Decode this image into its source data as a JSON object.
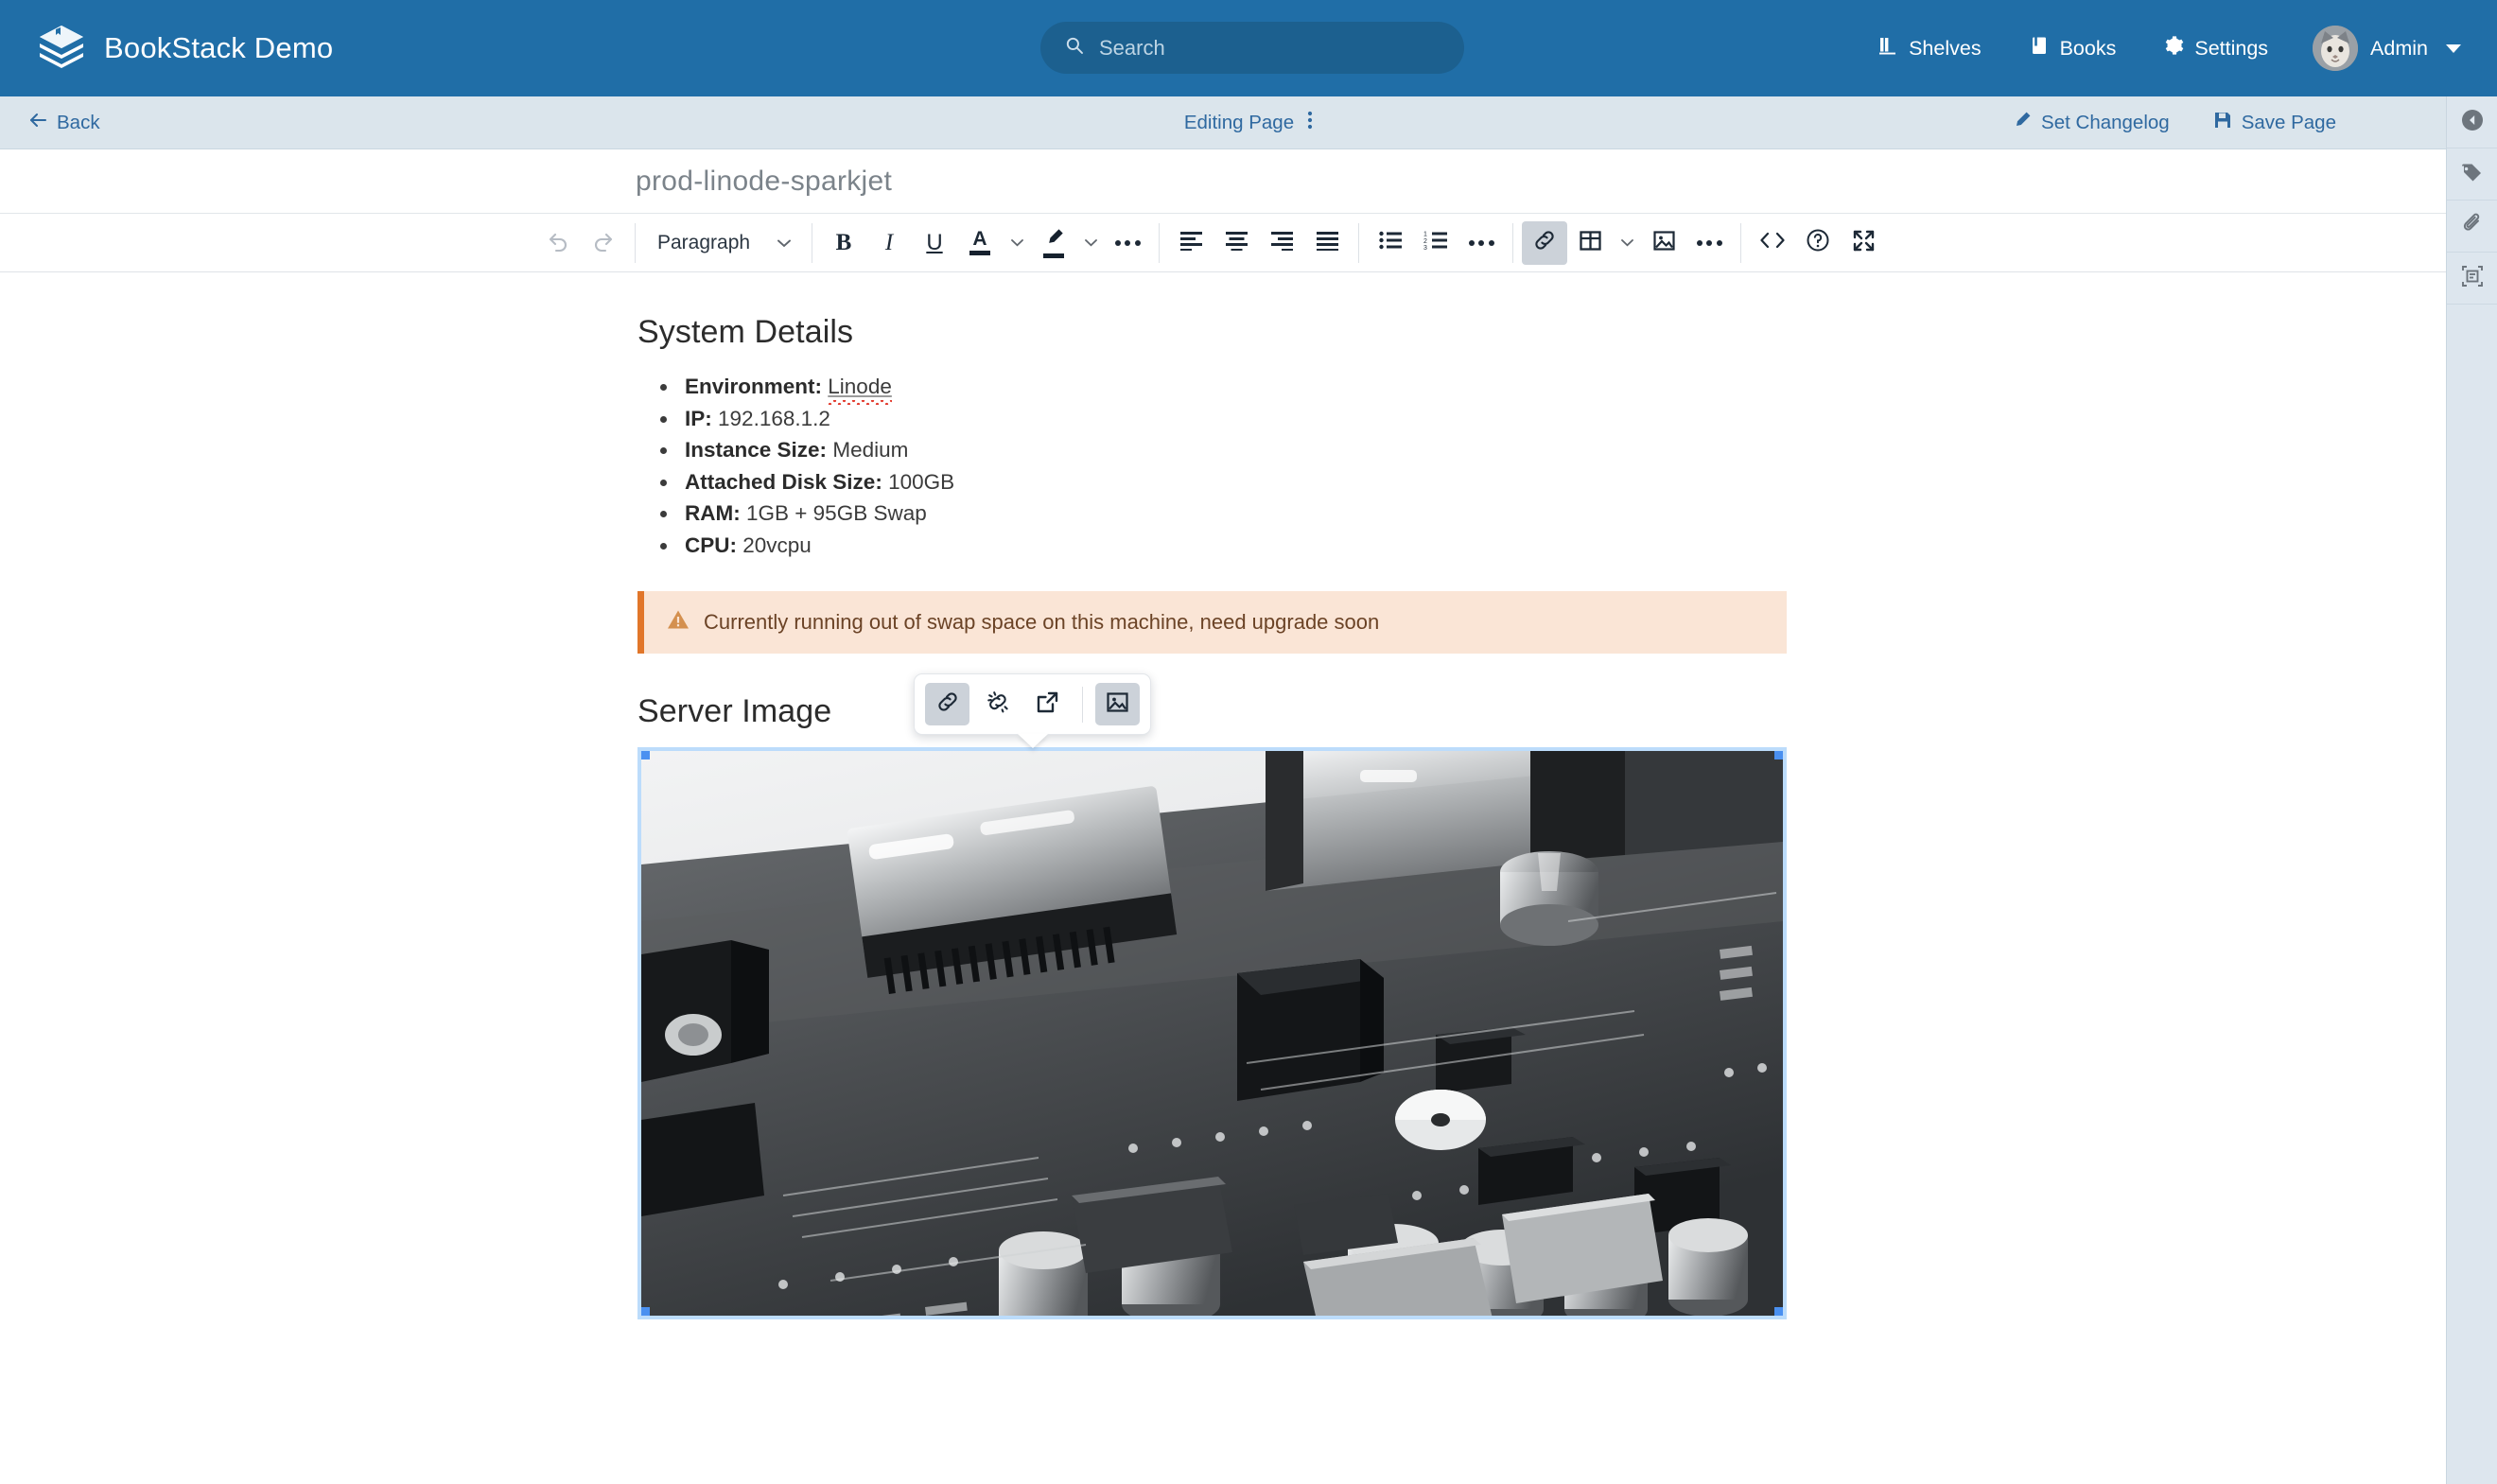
{
  "app": {
    "brand_name": "BookStack Demo",
    "logo_icon": "stacked-books-icon",
    "header_color": "#206ea7",
    "accent_color": "#2f69a0"
  },
  "search": {
    "placeholder": "Search",
    "value": "",
    "icon": "search-icon"
  },
  "header_nav": [
    {
      "label": "Shelves",
      "icon": "shelves-icon"
    },
    {
      "label": "Books",
      "icon": "book-icon"
    },
    {
      "label": "Settings",
      "icon": "gear-icon"
    }
  ],
  "user": {
    "name": "Admin",
    "avatar_icon": "cat-avatar",
    "caret_icon": "chevron-down-icon"
  },
  "action_bar": {
    "back_label": "Back",
    "back_icon": "arrow-left-icon",
    "status_label": "Editing Page",
    "status_menu_icon": "vertical-dots-icon",
    "changelog_label": "Set Changelog",
    "changelog_icon": "pencil-icon",
    "save_label": "Save Page",
    "save_icon": "floppy-disk-icon"
  },
  "rail": [
    {
      "icon": "collapse-left-icon",
      "name": "sidebar-toggle"
    },
    {
      "icon": "tag-icon",
      "name": "page-tags"
    },
    {
      "icon": "paperclip-icon",
      "name": "page-attachments"
    },
    {
      "icon": "template-icon",
      "name": "page-templates"
    }
  ],
  "page": {
    "title": "prod-linode-sparkjet"
  },
  "toolbar": {
    "undo_icon": "undo-icon",
    "redo_icon": "redo-icon",
    "format_value": "Paragraph",
    "format_caret": "chevron-down-icon",
    "bold_label": "B",
    "italic_label": "I",
    "underline_label": "U",
    "text_color_label": "A",
    "text_color_caret": "chevron-down-icon",
    "highlight_icon": "highlighter-icon",
    "highlight_caret": "chevron-down-icon",
    "format_more_icon": "ellipsis-icon",
    "align_left_icon": "align-left-icon",
    "align_center_icon": "align-center-icon",
    "align_right_icon": "align-right-icon",
    "align_justify_icon": "align-justify-icon",
    "bullet_list_icon": "bullet-list-icon",
    "numbered_list_icon": "numbered-list-icon",
    "list_more_icon": "ellipsis-icon",
    "link_icon": "link-icon",
    "table_icon": "table-icon",
    "table_caret": "chevron-down-icon",
    "image_icon": "image-icon",
    "insert_more_icon": "ellipsis-icon",
    "source_code_icon": "code-icon",
    "help_icon": "question-circle-icon",
    "fullscreen_icon": "fullscreen-icon"
  },
  "content": {
    "heading_system": "System Details",
    "details": [
      {
        "label": "Environment:",
        "value": "Linode",
        "misspelled": true
      },
      {
        "label": "IP:",
        "value": "192.168.1.2",
        "misspelled": false
      },
      {
        "label": "Instance Size:",
        "value": "Medium",
        "misspelled": false
      },
      {
        "label": "Attached Disk Size:",
        "value": "100GB",
        "misspelled": false
      },
      {
        "label": "RAM:",
        "value": "1GB + 95GB Swap",
        "misspelled": false
      },
      {
        "label": "CPU:",
        "value": "20vcpu",
        "misspelled": false
      }
    ],
    "callout": {
      "icon": "warning-triangle-icon",
      "text": "Currently running out of swap space on this machine, need upgrade soon",
      "background": "#fae5d6",
      "border_color": "#e1762a"
    },
    "heading_image": "Server Image",
    "image_alt": "circuit board close-up, greyscale",
    "selected": true,
    "selection_color": "#4a90f0"
  },
  "image_popup": {
    "buttons": [
      {
        "icon": "link-icon",
        "name": "insert-link",
        "active": true
      },
      {
        "icon": "unlink-icon",
        "name": "remove-link",
        "active": false
      },
      {
        "icon": "external-link-icon",
        "name": "open-link",
        "active": false
      },
      {
        "icon": "image-icon",
        "name": "edit-image",
        "active": true
      }
    ]
  }
}
